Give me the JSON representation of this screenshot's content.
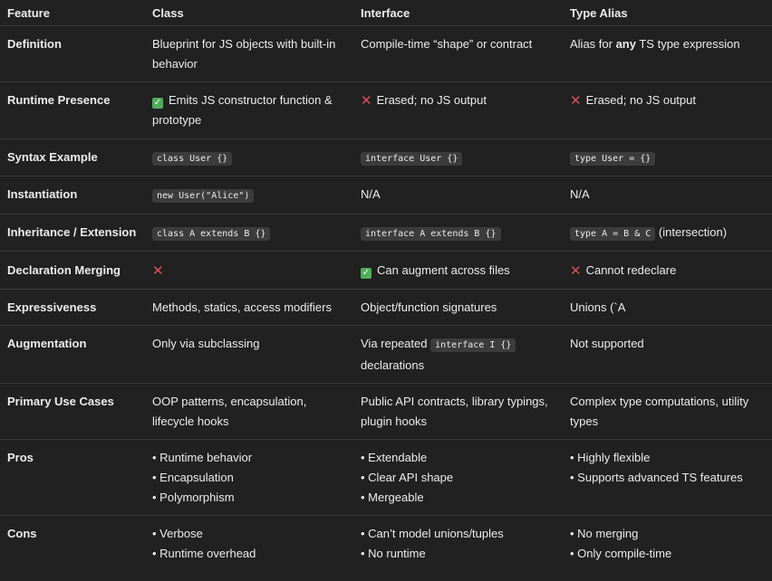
{
  "headers": [
    "Feature",
    "Class",
    "Interface",
    "Type Alias"
  ],
  "rows": {
    "definition": {
      "feature": "Definition",
      "class": "Blueprint for JS objects with built-in behavior",
      "interface": "Compile-time “shape” or contract",
      "alias_pre": "Alias for ",
      "alias_bold": "any",
      "alias_post": " TS type expression"
    },
    "runtime": {
      "feature": "Runtime Presence",
      "class": "Emits JS constructor function & prototype",
      "interface": "Erased; no JS output",
      "alias": "Erased; no JS output"
    },
    "syntax": {
      "feature": "Syntax Example",
      "class": "class User {}",
      "interface": "interface User {}",
      "alias": "type User = {}"
    },
    "instantiation": {
      "feature": "Instantiation",
      "class": "new User(\"Alice\")",
      "interface": "N/A",
      "alias": "N/A"
    },
    "inheritance": {
      "feature": "Inheritance / Extension",
      "class": "class A extends B {}",
      "interface": "interface A extends B {}",
      "alias_code": "type A = B & C",
      "alias_text": " (intersection)"
    },
    "merging": {
      "feature": "Declaration Merging",
      "interface": "Can augment across files",
      "alias": "Cannot redeclare"
    },
    "expressiveness": {
      "feature": "Expressiveness",
      "class": "Methods, statics, access modifiers",
      "interface": "Object/function signatures",
      "alias": "Unions (`A"
    },
    "augmentation": {
      "feature": "Augmentation",
      "class": "Only via subclassing",
      "interface_pre": "Via repeated ",
      "interface_code": "interface I {}",
      "interface_post": " declarations",
      "alias": "Not supported"
    },
    "usecases": {
      "feature": "Primary Use Cases",
      "class": "OOP patterns, encapsulation, lifecycle hooks",
      "interface": "Public API contracts, library typings, plugin hooks",
      "alias": "Complex type computations, utility types"
    },
    "pros": {
      "feature": "Pros",
      "class": [
        "• Runtime behavior",
        "• Encapsulation",
        "• Polymorphism"
      ],
      "interface": [
        "• Extendable",
        "• Clear API shape",
        "• Mergeable"
      ],
      "alias": [
        "• Highly flexible",
        "• Supports advanced TS features"
      ]
    },
    "cons": {
      "feature": "Cons",
      "class": [
        "• Verbose",
        "• Runtime overhead"
      ],
      "interface": [
        "• Can’t model unions/tuples",
        "• No runtime"
      ],
      "alias": [
        "• No merging",
        "• Only compile-time"
      ]
    }
  },
  "icons": {
    "check": "check-icon",
    "cross": "cross-icon",
    "check_color": "#4fae5a",
    "cross_color": "#e0505a"
  }
}
